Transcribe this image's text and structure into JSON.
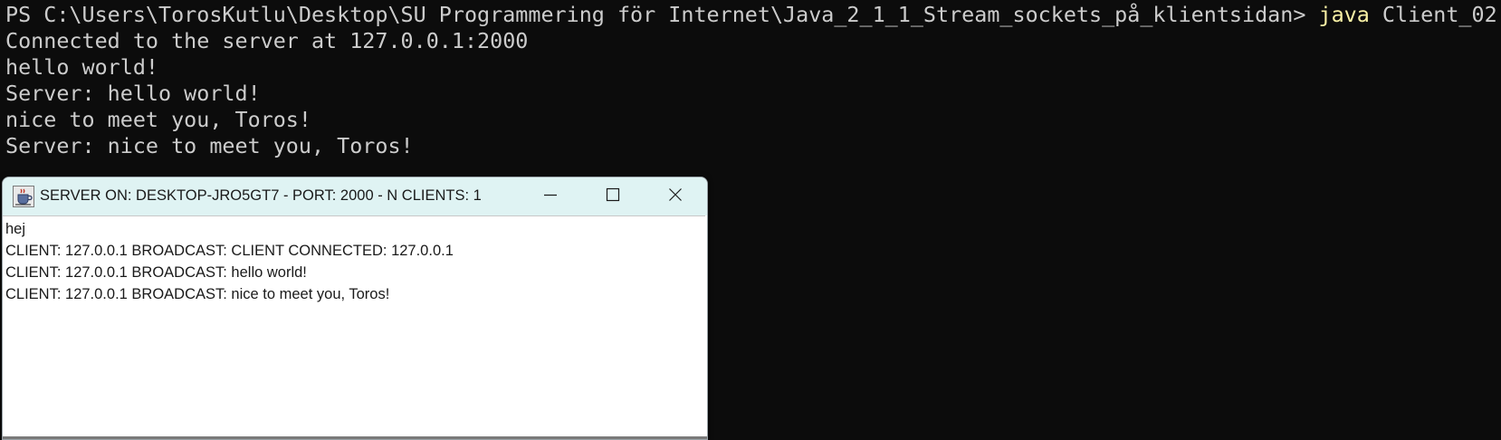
{
  "terminal": {
    "prompt": "PS C:\\Users\\TorosKutlu\\Desktop\\SU Programmering för Internet\\Java_2_1_1_Stream_sockets_på_klientsidan> ",
    "command": "java",
    "command_arg": " Client_02",
    "lines": [
      "Connected to the server at 127.0.0.1:2000",
      "hello world!",
      "Server: hello world!",
      "nice to meet you, Toros!",
      "Server: nice to meet you, Toros!"
    ],
    "colors": {
      "background": "#0c0c0c",
      "text": "#cccccc",
      "command": "#f9f1a5"
    }
  },
  "server_window": {
    "title": "SERVER ON: DESKTOP-JRO5GT7 - PORT: 2000 - N CLIENTS: 1",
    "icon": "java-coffee-cup-icon",
    "controls": {
      "minimize": "minimize-icon",
      "maximize": "maximize-icon",
      "close": "close-icon"
    },
    "log": [
      "hej",
      "CLIENT: 127.0.0.1 BROADCAST: CLIENT CONNECTED: 127.0.0.1",
      "CLIENT: 127.0.0.1 BROADCAST: hello world!",
      "CLIENT: 127.0.0.1 BROADCAST: nice to meet you, Toros!"
    ],
    "colors": {
      "titlebar": "#dff3f3",
      "content": "#ffffff"
    }
  }
}
